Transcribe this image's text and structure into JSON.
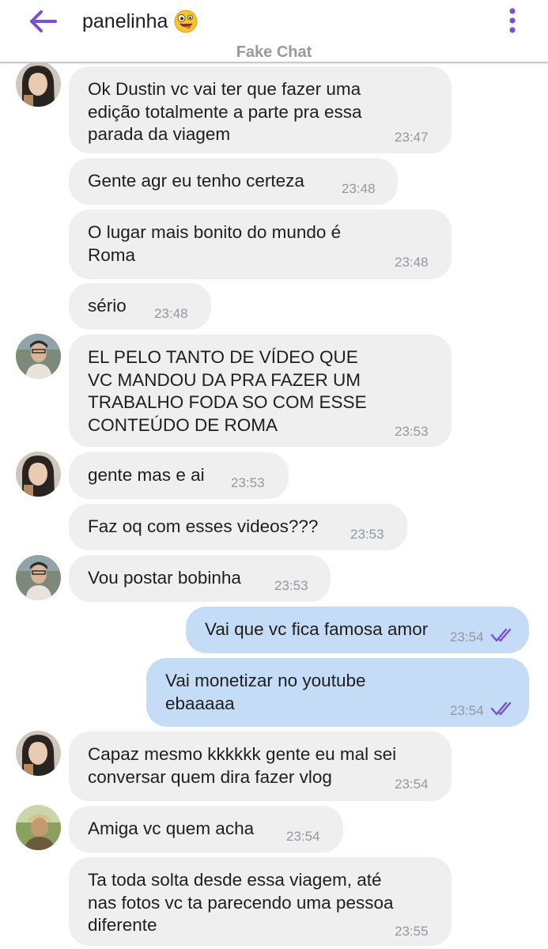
{
  "header": {
    "title": "panelinha",
    "subtitle": "Fake Chat",
    "accent_color": "#7a4fd6",
    "icons": [
      "back-arrow-icon",
      "emoji-crazy-face-icon",
      "more-vert-icon"
    ]
  },
  "messages": [
    {
      "lines": "Ok Dustin vc vai ter que fazer uma\nedição totalmente a parte pra essa\nparada da viagem",
      "time": "23:47"
    },
    {
      "lines": "Gente agr eu tenho certeza",
      "time": "23:48"
    },
    {
      "lines": "O lugar mais bonito do mundo é\nRoma",
      "time": "23:48"
    },
    {
      "lines": "sério",
      "time": "23:48"
    },
    {
      "lines": "EL PELO TANTO DE VÍDEO QUE\nVC MANDOU DA PRA FAZER UM\nTRABALHO FODA SO COM ESSE\nCONTEÚDO DE ROMA",
      "time": "23:53"
    },
    {
      "lines": "gente mas e ai",
      "time": "23:53"
    },
    {
      "lines": "Faz oq com esses videos???",
      "time": "23:53"
    },
    {
      "lines": "Vou postar bobinha",
      "time": "23:53"
    },
    {
      "lines": "Vai que vc fica famosa amor",
      "time": "23:54"
    },
    {
      "lines": "Vai monetizar no youtube\nebaaaaa",
      "time": "23:54"
    },
    {
      "lines": "Capaz mesmo kkkkkk gente eu mal sei\nconversar quem dira fazer vlog",
      "time": "23:54"
    },
    {
      "lines": "Amiga vc quem acha",
      "time": "23:54"
    },
    {
      "lines": "Ta toda solta desde essa viagem, até\nnas fotos vc ta parecendo uma pessoa\ndiferente",
      "time": "23:55"
    }
  ]
}
